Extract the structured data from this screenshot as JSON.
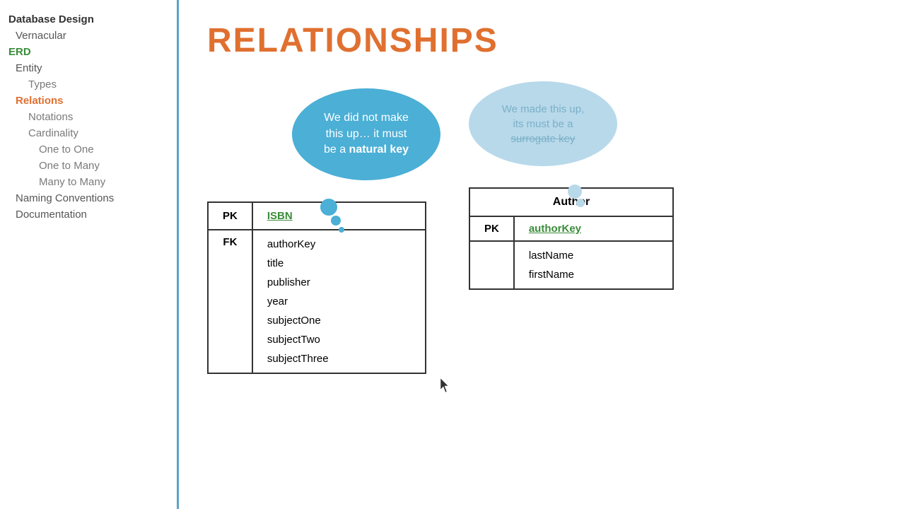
{
  "sidebar": {
    "items": [
      {
        "id": "database-design",
        "label": "Database Design",
        "level": "level0",
        "active": false
      },
      {
        "id": "vernacular",
        "label": "Vernacular",
        "level": "level1",
        "active": false
      },
      {
        "id": "erd",
        "label": "ERD",
        "level": "level0",
        "active": false,
        "style": "active-green"
      },
      {
        "id": "entity",
        "label": "Entity",
        "level": "level1",
        "active": false
      },
      {
        "id": "types",
        "label": "Types",
        "level": "level2",
        "active": false
      },
      {
        "id": "relations",
        "label": "Relations",
        "level": "level1",
        "active": true,
        "style": "active-orange"
      },
      {
        "id": "notations",
        "label": "Notations",
        "level": "level2",
        "active": false
      },
      {
        "id": "cardinality",
        "label": "Cardinality",
        "level": "level2",
        "active": false
      },
      {
        "id": "one-to-one",
        "label": "One to One",
        "level": "level2 sub",
        "active": false
      },
      {
        "id": "one-to-many",
        "label": "One to Many",
        "level": "level2 sub",
        "active": false
      },
      {
        "id": "many-to-many",
        "label": "Many to Many",
        "level": "level2 sub",
        "active": false
      },
      {
        "id": "naming-conventions",
        "label": "Naming Conventions",
        "level": "level1",
        "active": false
      },
      {
        "id": "documentation",
        "label": "Documentation",
        "level": "level1",
        "active": false
      }
    ]
  },
  "main": {
    "title": "RELATIONSHIPS",
    "bubble_natural": {
      "line1": "We did not make",
      "line2": "this up… it must",
      "line3": "be a ",
      "bold": "natural key"
    },
    "bubble_surrogate": {
      "line1": "We made this up,",
      "line2": "its must be a",
      "line3": "surrogate key"
    },
    "book_table": {
      "pk_label": "PK",
      "fk_label": "FK",
      "isbn_label": "ISBN",
      "fields": [
        "authorKey",
        "title",
        "publisher",
        "year",
        "subjectOne",
        "subjectTwo",
        "subjectThree"
      ]
    },
    "author_table": {
      "title": "Author",
      "pk_label": "PK",
      "pk_field": "authorKey",
      "fields": [
        "lastName",
        "firstName"
      ]
    }
  }
}
